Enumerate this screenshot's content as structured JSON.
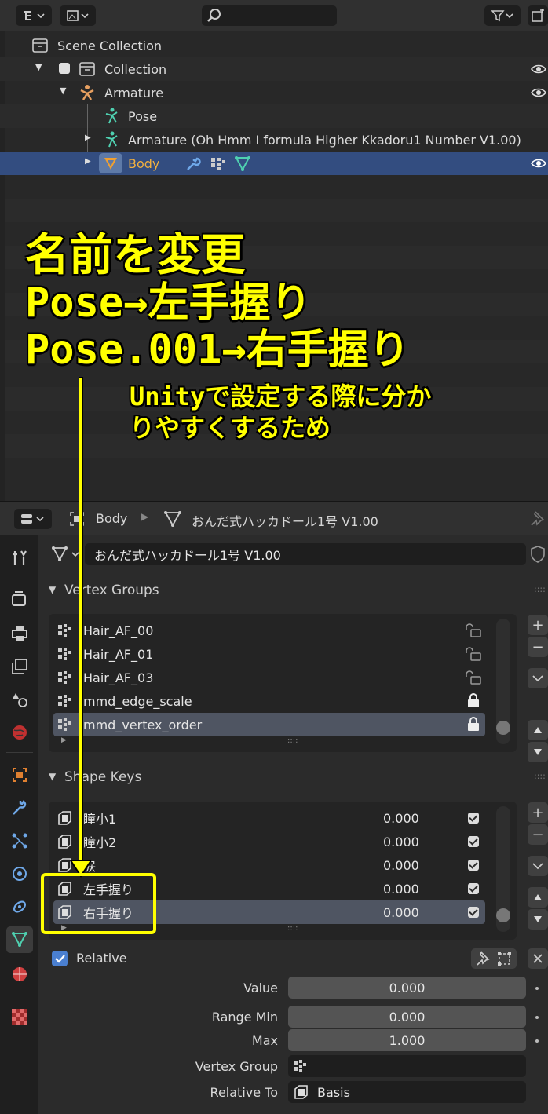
{
  "outliner": {
    "rows": [
      {
        "label": "Scene Collection"
      },
      {
        "label": "Collection"
      },
      {
        "label": "Armature"
      },
      {
        "label": "Pose"
      },
      {
        "label": "Armature (Oh Hmm I formula Higher Kkadoru1 Number V1.00)"
      },
      {
        "label": "Body"
      }
    ]
  },
  "annotation": {
    "line1": "名前を変更",
    "line2": "Pose→左手握り",
    "line3": "Pose.001→右手握り",
    "note_line1": "Unityで設定する際に分か",
    "note_line2": "りやすくするため"
  },
  "properties": {
    "breadcrumb_object": "Body",
    "breadcrumb_mesh": "おんだ式ハッカドール1号 V1.00",
    "mesh_name": "おんだ式ハッカドール1号 V1.00",
    "vertex_groups": {
      "title": "Vertex Groups",
      "items": [
        {
          "name": "Hair_AF_00"
        },
        {
          "name": "Hair_AF_01"
        },
        {
          "name": "Hair_AF_03"
        },
        {
          "name": "mmd_edge_scale"
        },
        {
          "name": "mmd_vertex_order"
        }
      ]
    },
    "shape_keys": {
      "title": "Shape Keys",
      "items": [
        {
          "name": "瞳小1",
          "value": "0.000"
        },
        {
          "name": "瞳小2",
          "value": "0.000"
        },
        {
          "name": "涙",
          "value": "0.000"
        },
        {
          "name": "左手握り",
          "value": "0.000"
        },
        {
          "name": "右手握り",
          "value": "0.000"
        }
      ]
    },
    "relative_label": "Relative",
    "fields": {
      "value_label": "Value",
      "value": "0.000",
      "range_min_label": "Range Min",
      "range_min": "0.000",
      "max_label": "Max",
      "max": "1.000",
      "vertex_group_label": "Vertex Group",
      "vertex_group": "",
      "relative_to_label": "Relative To",
      "relative_to": "Basis"
    },
    "plus": "+",
    "minus": "−",
    "grip": "::::"
  },
  "colors": {
    "accent_selected": "#334d80",
    "annotation": "#ffff00",
    "active_object": "#f0a030"
  }
}
